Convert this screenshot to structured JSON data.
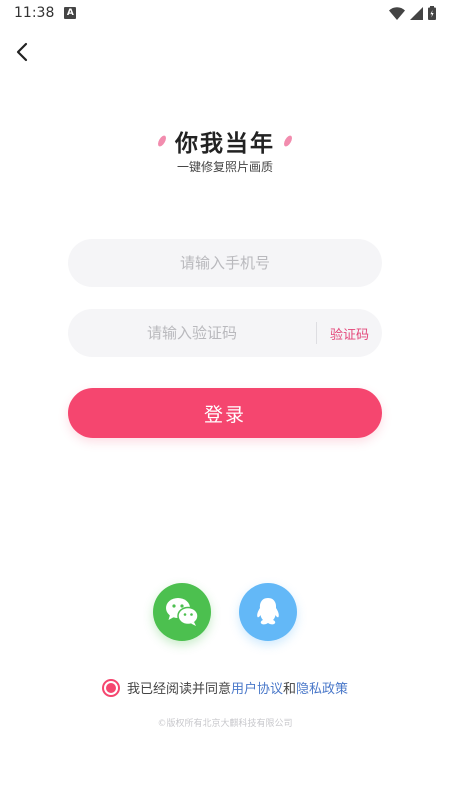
{
  "status_bar": {
    "time": "11:38",
    "notification_icon": "A"
  },
  "header": {
    "back_icon": "chevron-left-icon"
  },
  "branding": {
    "title": "你我当年",
    "subtitle": "一键修复照片画质"
  },
  "form": {
    "phone_placeholder": "请输入手机号",
    "phone_value": "",
    "code_placeholder": "请输入验证码",
    "code_value": "",
    "get_code_label": "验证码",
    "login_label": "登录"
  },
  "social_login": {
    "wechat_icon": "wechat-icon",
    "qq_icon": "qq-icon"
  },
  "agreement": {
    "checked": true,
    "prefix": "我已经阅读并同意",
    "user_agreement": "用户协议",
    "conjunction": "和",
    "privacy_policy": "隐私政策"
  },
  "footer": {
    "copyright": "©版权所有北京大麒科技有限公司"
  },
  "colors": {
    "accent": "#f5466f",
    "wechat": "#4cc04f",
    "qq": "#63b8f7",
    "link": "#4a78c9",
    "input_bg": "#f5f5f7"
  }
}
